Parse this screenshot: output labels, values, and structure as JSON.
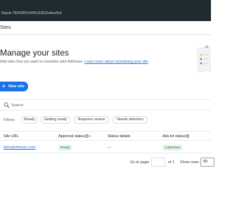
{
  "browser": {
    "url": "0/pub-7824281644616263/sites/list"
  },
  "header": {
    "breadcrumb": "Sites"
  },
  "page": {
    "title": "Manage your sites",
    "description": "Add sites that you want to monetise with AdSense.",
    "learn_more_link": "Learn more about monetising your site"
  },
  "actions": {
    "new_site_label": "New site"
  },
  "search": {
    "placeholder": "Search"
  },
  "filters": {
    "label": "Filters:",
    "chips": [
      "Ready",
      "Getting ready",
      "Requires review",
      "Needs attention"
    ]
  },
  "table": {
    "columns": [
      "Site URL",
      "Approval status",
      "Status details",
      "Ads.txt status"
    ],
    "rows": [
      {
        "site_url": "illshadofmusic.com",
        "approval_status": "Ready",
        "status_details": "—",
        "ads_txt_status": "Authorised"
      }
    ]
  },
  "pagination": {
    "go_to_page_label": "Go to page:",
    "of_label": "of 1",
    "show_rows_label": "Show rows:",
    "rows_value": "50"
  },
  "colors": {
    "accent": "#1a73e8",
    "url_bar": "#202b2f",
    "ready_badge_bg": "#e6f4ea",
    "ready_badge_text": "#137333"
  }
}
